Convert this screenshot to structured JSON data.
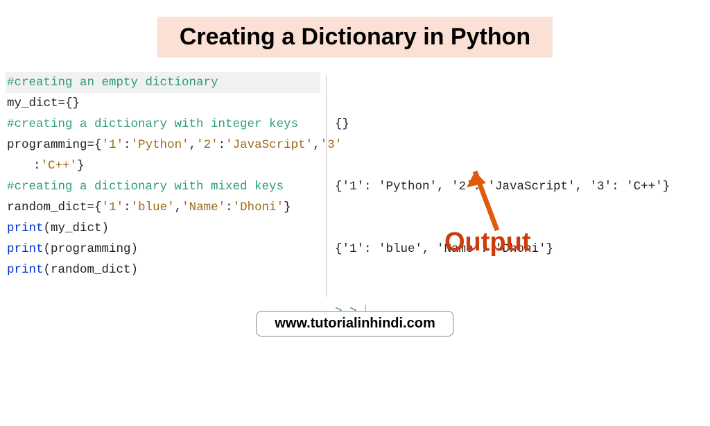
{
  "title": "Creating a Dictionary in Python",
  "code": {
    "l1_comment": "#creating an empty dictionary",
    "l2_a": "my_dict",
    "l2_b": "=",
    "l2_c": "{}",
    "l3_comment": "#creating a dictionary with integer keys",
    "l4_a": "programming",
    "l4_b": "=",
    "l4_c": "{",
    "l4_d": "'1'",
    "l4_e": ":",
    "l4_f": "'Python'",
    "l4_g": ",",
    "l4_h": "'2'",
    "l4_i": ":",
    "l4_j": "'JavaScript'",
    "l4_k": ",",
    "l4_l": "'3'",
    "l5_a": ":",
    "l5_b": "'C++'",
    "l5_c": "}",
    "l6_comment": "#creating a dictionary with mixed keys",
    "l7_a": "random_dict",
    "l7_b": "=",
    "l7_c": "{",
    "l7_d": "'1'",
    "l7_e": ":",
    "l7_f": "'blue'",
    "l7_g": ",",
    "l7_h": "'Name'",
    "l7_i": ":",
    "l7_j": "'Dhoni'",
    "l7_k": "}",
    "l8_a": "print",
    "l8_b": "(my_dict)",
    "l9_a": "print",
    "l9_b": "(programming)",
    "l10_a": "print",
    "l10_b": "(random_dict)"
  },
  "output": {
    "line1": "{}",
    "line2": "{'1': 'Python', '2': 'JavaScript', '3': 'C++'}",
    "line3": "{'1': 'blue', 'Name': 'Dhoni'}",
    "prompt1": ">",
    "prompt2": ">",
    "label": "Output"
  },
  "footer": "www.tutorialinhindi.com"
}
